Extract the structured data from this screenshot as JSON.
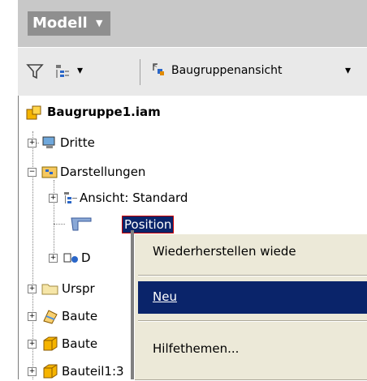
{
  "panel": {
    "title": "Modell",
    "title_arrow": "▼"
  },
  "toolbar": {
    "filter_arrow": "▾",
    "view_label": "Baugruppenansicht",
    "view_arrow": "▾"
  },
  "tree": {
    "root": "Baugruppe1.iam",
    "items": [
      {
        "label": "Dritte"
      },
      {
        "label": "Darstellungen"
      },
      {
        "label": "Ansicht: Standard"
      },
      {
        "label": "Position"
      },
      {
        "label": "D"
      },
      {
        "label": "Urspr"
      },
      {
        "label": "Baute"
      },
      {
        "label": "Baute"
      },
      {
        "label": "Bauteil1:3"
      }
    ],
    "expander_plus": "+",
    "expander_minus": "−"
  },
  "context_menu": {
    "items": [
      {
        "label": "Wiederherstellen wiede"
      },
      {
        "label": "Neu"
      },
      {
        "label": "Hilfethemen..."
      }
    ]
  },
  "colors": {
    "selection": "#0a246a",
    "menu_bg": "#ece9d8",
    "header": "#8f8f8f"
  }
}
